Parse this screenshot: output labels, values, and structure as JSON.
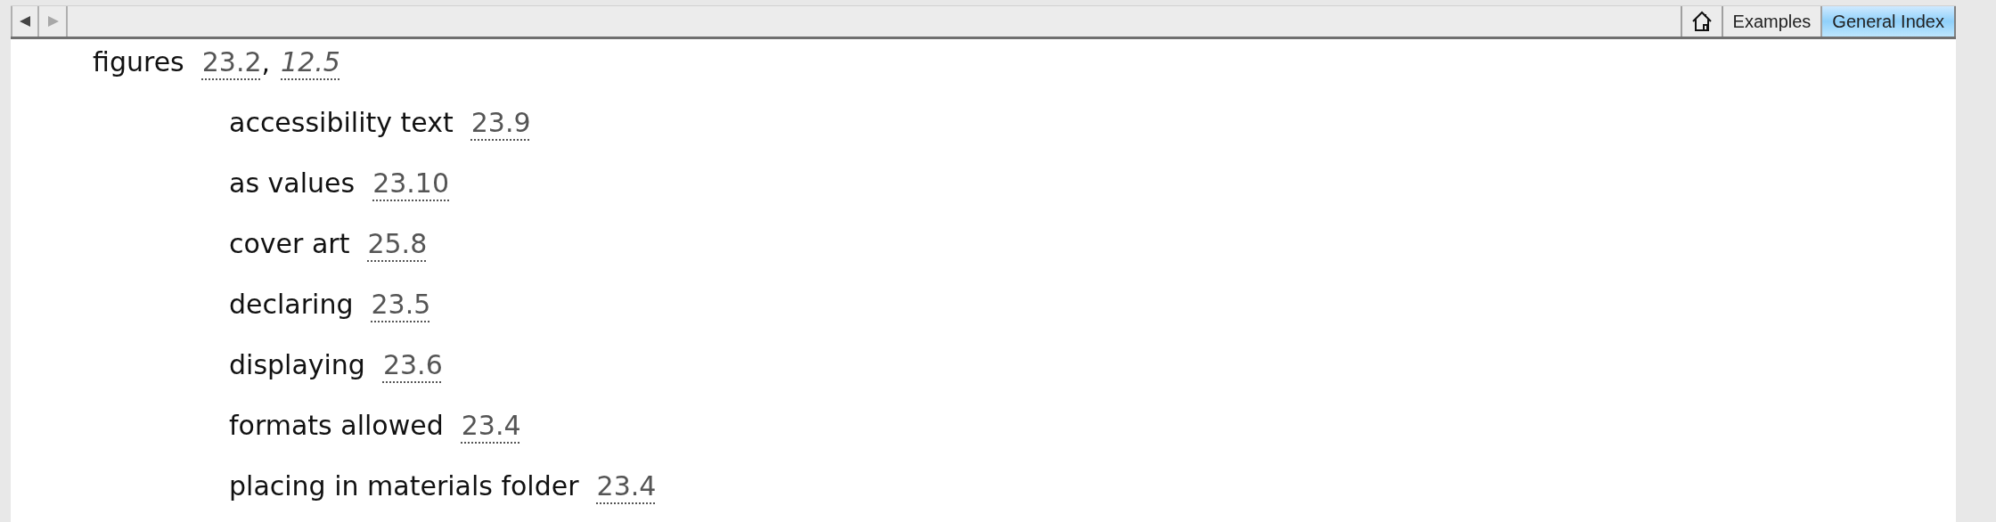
{
  "toolbar": {
    "nav": [
      {
        "kind": "back",
        "disabled": false
      },
      {
        "kind": "forward",
        "disabled": true
      }
    ],
    "tabs": [
      {
        "kind": "home",
        "selected": false
      },
      {
        "kind": "text",
        "label": "Examples",
        "selected": false
      },
      {
        "kind": "text",
        "label": "General Index",
        "selected": true
      }
    ]
  },
  "index": {
    "term": "figures",
    "separator": ",",
    "refs": [
      {
        "text": "23.2",
        "italic": false
      },
      {
        "text": "12.5",
        "italic": true
      }
    ],
    "children": [
      {
        "term": "accessibility text",
        "refs": [
          {
            "text": "23.9",
            "italic": false
          }
        ]
      },
      {
        "term": "as values",
        "refs": [
          {
            "text": "23.10",
            "italic": false
          }
        ]
      },
      {
        "term": "cover art",
        "refs": [
          {
            "text": "25.8",
            "italic": false
          }
        ]
      },
      {
        "term": "declaring",
        "refs": [
          {
            "text": "23.5",
            "italic": false
          }
        ]
      },
      {
        "term": "displaying",
        "refs": [
          {
            "text": "23.6",
            "italic": false
          }
        ]
      },
      {
        "term": "formats allowed",
        "refs": [
          {
            "text": "23.4",
            "italic": false
          }
        ]
      },
      {
        "term": "placing in materials folder",
        "refs": [
          {
            "text": "23.4",
            "italic": false
          }
        ]
      }
    ]
  }
}
